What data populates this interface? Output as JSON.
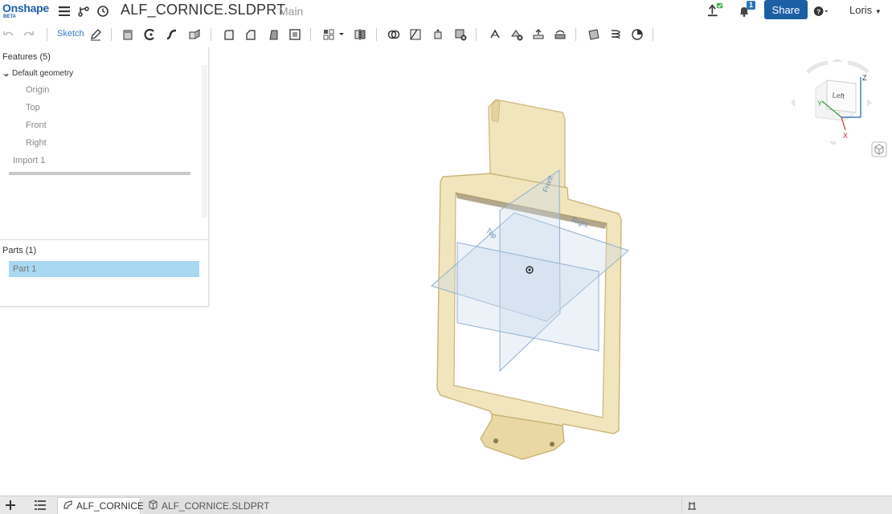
{
  "app": {
    "logo": "Onshape",
    "beta": "BETA"
  },
  "header": {
    "title": "ALF_CORNICE.SLDPRT",
    "workspace": "Main",
    "notification_count": "1",
    "share_label": "Share",
    "user_name": "Loris"
  },
  "toolbar": {
    "sketch_label": "Sketch"
  },
  "feature_panel": {
    "features_header": "Features (5)",
    "default_geometry": "Default geometry",
    "items": [
      "Origin",
      "Top",
      "Front",
      "Right"
    ],
    "import_item": "Import 1",
    "parts_header": "Parts (1)",
    "parts": [
      "Part 1"
    ]
  },
  "viewport": {
    "plane_labels": [
      "Top",
      "Front",
      "Right"
    ],
    "view_cube_face": "Left",
    "axes": [
      "Z",
      "Y",
      "X"
    ],
    "model_color": "#f2e6bf",
    "model_edge_color": "#d8c58e",
    "plane_color": "#c9d9ea"
  },
  "bottom_tabs": {
    "tabs": [
      {
        "label": "ALF_CORNICE",
        "active": true
      },
      {
        "label": "ALF_CORNICE.SLDPRT",
        "active": false
      }
    ]
  }
}
